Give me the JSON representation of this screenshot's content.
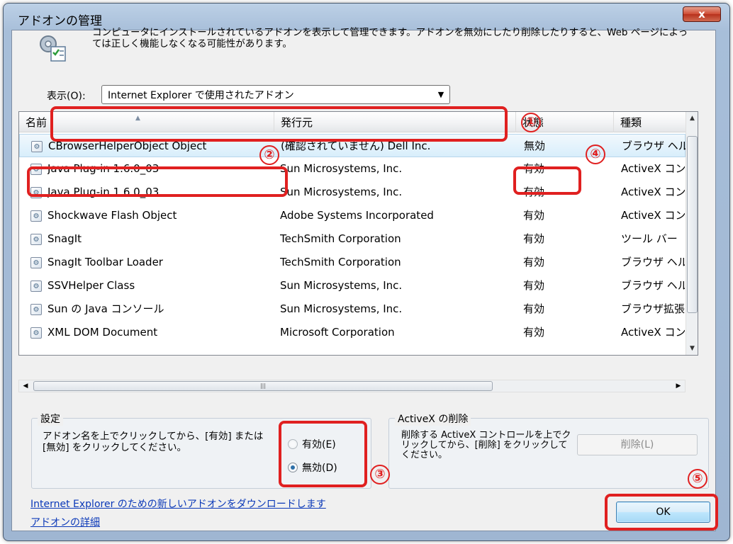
{
  "window": {
    "title": "アドオンの管理",
    "close_glyph": "x"
  },
  "description": "コンピュータにインストールされているアドオンを表示して管理できます。アドオンを無効にしたり削除したりすると、Web ページによっては正しく機能しなくなる可能性があります。",
  "show": {
    "label": "表示(O):",
    "selected": "Internet Explorer で使用されたアドオン"
  },
  "list": {
    "columns": [
      "名前",
      "発行元",
      "状態",
      "種類"
    ],
    "rows": [
      {
        "name": "CBrowserHelperObject Object",
        "publisher": "(確認されていません) Dell Inc.",
        "status": "無効",
        "type": "ブラウザ ヘル"
      },
      {
        "name": "Java Plug-in 1.6.0_03",
        "publisher": "Sun Microsystems, Inc.",
        "status": "有効",
        "type": "ActiveX コン"
      },
      {
        "name": "Java Plug-in 1.6.0_03",
        "publisher": "Sun Microsystems, Inc.",
        "status": "有効",
        "type": "ActiveX コン"
      },
      {
        "name": "Shockwave Flash Object",
        "publisher": "Adobe Systems Incorporated",
        "status": "有効",
        "type": "ActiveX コン"
      },
      {
        "name": "SnagIt",
        "publisher": "TechSmith Corporation",
        "status": "有効",
        "type": "ツール バー"
      },
      {
        "name": "SnagIt Toolbar Loader",
        "publisher": "TechSmith Corporation",
        "status": "有効",
        "type": "ブラウザ ヘル"
      },
      {
        "name": "SSVHelper Class",
        "publisher": "Sun Microsystems, Inc.",
        "status": "有効",
        "type": "ブラウザ ヘル"
      },
      {
        "name": "Sun の Java コンソール",
        "publisher": "Sun Microsystems, Inc.",
        "status": "有効",
        "type": "ブラウザ拡張"
      },
      {
        "name": "XML DOM Document",
        "publisher": "Microsoft Corporation",
        "status": "有効",
        "type": "ActiveX コン"
      }
    ]
  },
  "settings": {
    "title": "設定",
    "desc": "アドオン名を上でクリックしてから、[有効] または [無効] をクリックしてください。",
    "enable": "有効(E)",
    "disable": "無効(D)"
  },
  "activex": {
    "title": "ActiveX の削除",
    "desc": "削除する ActiveX コントロールを上でクリックしてから、[削除] をクリックしてください。",
    "delete": "削除(L)"
  },
  "links": {
    "download": "Internet Explorer のための新しいアドオンをダウンロードします",
    "details": "アドオンの詳細"
  },
  "ok": "OK",
  "annotations": [
    "①",
    "②",
    "③",
    "④",
    "⑤"
  ],
  "colors": {
    "annotation": "#e02020",
    "link": "#0a38b8",
    "selection": "#d8eefb"
  }
}
